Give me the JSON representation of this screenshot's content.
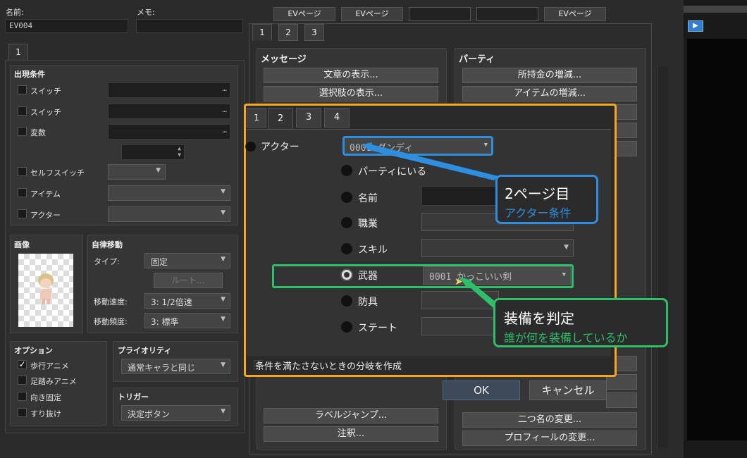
{
  "header": {
    "name_label": "名前:",
    "name_value": "EV004",
    "memo_label": "メモ:",
    "page_tabs": [
      "EVページ",
      "EVページ",
      "",
      "",
      "EVページ"
    ]
  },
  "left_tab": "1",
  "conditions": {
    "title": "出現条件",
    "switch1": "スイッチ",
    "switch2": "スイッチ",
    "variable": "変数",
    "self_switch": "セルフスイッチ",
    "item": "アイテム",
    "actor": "アクター",
    "dots": "…"
  },
  "image": {
    "title": "画像"
  },
  "autonomous": {
    "title": "自律移動",
    "type_label": "タイプ:",
    "type_value": "固定",
    "route_button": "ルート...",
    "speed_label": "移動速度:",
    "speed_value": "3: 1/2倍速",
    "freq_label": "移動頻度:",
    "freq_value": "3: 標準"
  },
  "options": {
    "title": "オプション",
    "items": [
      {
        "label": "歩行アニメ",
        "checked": true
      },
      {
        "label": "足踏みアニメ",
        "checked": false
      },
      {
        "label": "向き固定",
        "checked": false
      },
      {
        "label": "すり抜け",
        "checked": false
      }
    ]
  },
  "priority": {
    "title": "プライオリティ",
    "value": "通常キャラと同じ"
  },
  "trigger": {
    "title": "トリガー",
    "value": "決定ボタン"
  },
  "commands": {
    "tabs": [
      "1",
      "2",
      "3"
    ],
    "message_title": "メッセージ",
    "party_title": "パーティ",
    "message_buttons": [
      "文章の表示...",
      "選択肢の表示..."
    ],
    "party_buttons": [
      "所持金の増減...",
      "アイテムの増減..."
    ],
    "bottom_left": [
      "ラベルジャンプ...",
      "注釈..."
    ],
    "bottom_right": [
      "二つ名の変更...",
      "プロフィールの変更..."
    ]
  },
  "dialog": {
    "tabs": [
      "1",
      "2",
      "3",
      "4"
    ],
    "actor_label": "アクター",
    "actor_value": "0001 ダンディ",
    "options": [
      {
        "label": "パーティにいる",
        "selected": false,
        "value": null
      },
      {
        "label": "名前",
        "selected": false,
        "value": ""
      },
      {
        "label": "職業",
        "selected": false,
        "value": ""
      },
      {
        "label": "スキル",
        "selected": false,
        "value": ""
      },
      {
        "label": "武器",
        "selected": true,
        "value": "0001 かっこいい剣"
      },
      {
        "label": "防具",
        "selected": false,
        "value": ""
      },
      {
        "label": "ステート",
        "selected": false,
        "value": ""
      }
    ],
    "else_branch": "条件を満たさないときの分岐を作成",
    "ok": "OK",
    "cancel": "キャンセル"
  },
  "annotations": {
    "blue_title": "2ページ目",
    "blue_sub": "アクター条件",
    "green_title": "装備を判定",
    "green_sub": "誰が何を装備しているか"
  },
  "colors": {
    "orange": "#f5a623",
    "blue": "#2e8fe0",
    "green": "#2fbf6a"
  }
}
